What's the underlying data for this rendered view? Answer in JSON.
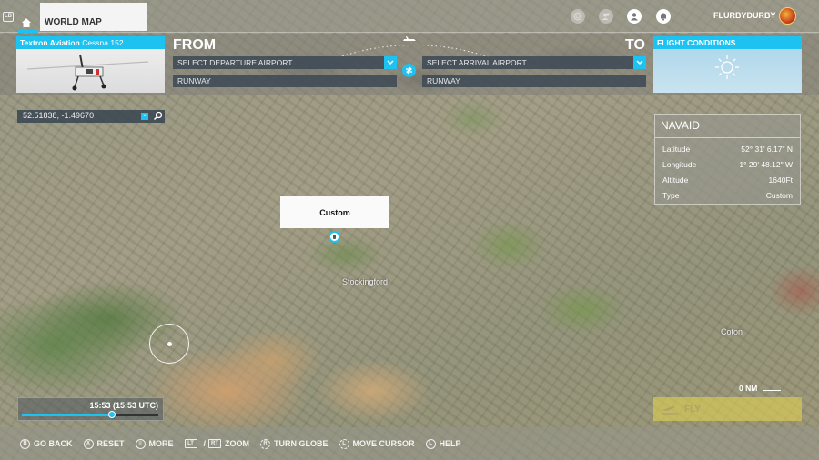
{
  "topbar": {
    "lb_label": "LB",
    "tab_label": "WORLD MAP",
    "username": "FLURBYDURBY",
    "icons": [
      "target-icon",
      "friends-icon",
      "profile-icon",
      "notification-bell-icon"
    ]
  },
  "planner": {
    "aircraft": {
      "maker": "Textron Aviation",
      "model": "Cessna 152"
    },
    "from_label": "FROM",
    "to_label": "TO",
    "departure_placeholder": "SELECT DEPARTURE AIRPORT",
    "arrival_placeholder": "SELECT ARRIVAL AIRPORT",
    "departure_runway": "RUNWAY",
    "arrival_runway": "RUNWAY",
    "conditions_title": "FLIGHT CONDITIONS",
    "conditions_icon": "sun-icon"
  },
  "search": {
    "value": "52.51838, -1.49670",
    "clear_label": "×"
  },
  "navaid": {
    "title": "NAVAID",
    "rows": [
      {
        "label": "Latitude",
        "value": "52° 31' 6.17\" N"
      },
      {
        "label": "Longitude",
        "value": "1° 29' 48.12\" W"
      },
      {
        "label": "Altitude",
        "value": "1640Ft"
      },
      {
        "label": "Type",
        "value": "Custom"
      }
    ]
  },
  "map": {
    "popup_label": "Custom",
    "place_labels": [
      "Stockingford",
      "Coton"
    ],
    "scale_label": "0 NM"
  },
  "time": {
    "label": "15:53 (15:53 UTC)",
    "progress": 0.66,
    "accent": "#1ec2f0"
  },
  "fly_button": {
    "label": "FLY"
  },
  "hints": [
    {
      "glyph": "B",
      "label": "GO BACK"
    },
    {
      "glyph": "X",
      "label": "RESET"
    },
    {
      "glyph": "≡",
      "label": "MORE"
    },
    {
      "glyph": "LT",
      "glyph2": "RT",
      "label": "ZOOM"
    },
    {
      "glyph": "R",
      "label": "TURN GLOBE"
    },
    {
      "glyph": "L",
      "label": "MOVE CURSOR"
    },
    {
      "glyph": "L",
      "label": "HELP"
    }
  ],
  "colors": {
    "accent": "#1ec2f0",
    "fly": "#e1d250"
  }
}
